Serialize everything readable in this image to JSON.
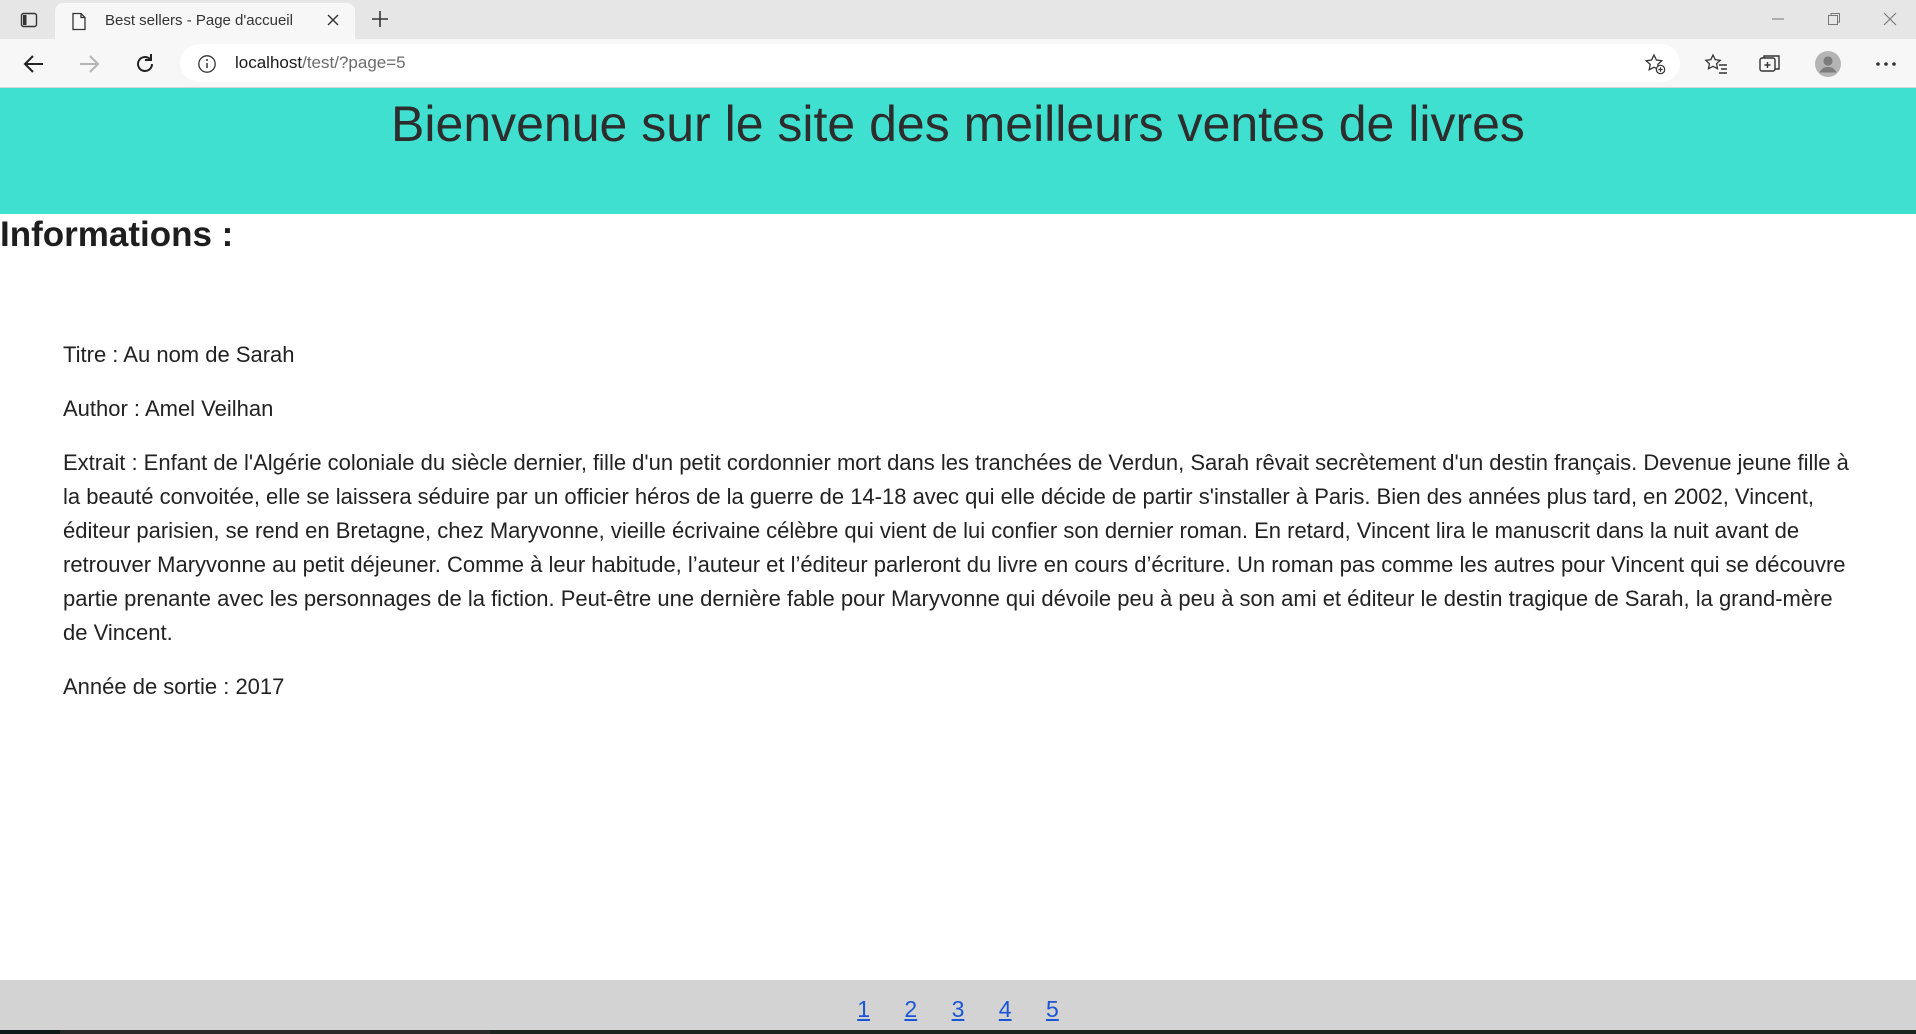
{
  "browser": {
    "tab_title": "Best sellers - Page d'accueil",
    "url_host": "localhost",
    "url_path": "/test/?page=5"
  },
  "page": {
    "banner_title": "Bienvenue sur le site des meilleurs ventes de livres",
    "section_title": "Informations :",
    "book": {
      "title_line": "Titre : Au nom de Sarah",
      "author_line": "Author : Amel Veilhan",
      "extrait_line": "Extrait : Enfant de l'Algérie coloniale du siècle dernier, fille d'un petit cordonnier mort dans les tranchées de Verdun, Sarah rêvait secrètement d'un destin français. Devenue jeune fille à la beauté convoitée, elle se laissera séduire par un officier héros de la guerre de 14-18 avec qui elle décide de partir s'installer à Paris. Bien des années plus tard, en 2002, Vincent, éditeur parisien, se rend en Bretagne, chez Maryvonne, vieille écrivaine célèbre qui vient de lui confier son dernier roman. En retard, Vincent lira le manuscrit dans la nuit avant de retrouver Maryvonne au petit déjeuner. Comme à leur habitude, l’auteur et l’éditeur parleront du livre en cours d’écriture. Un roman pas comme les autres pour Vincent qui se découvre partie prenante avec les personnages de la fiction. Peut-être une dernière fable pour Maryvonne qui dévoile peu à peu à son ami et éditeur le destin tragique de Sarah, la grand-mère de Vincent.",
      "year_line": "Année de sortie : 2017"
    },
    "pagination": [
      "1",
      "2",
      "3",
      "4",
      "5"
    ]
  },
  "colors": {
    "banner": "#40e0d0",
    "footer": "#d3d3d3",
    "link": "#1a55d6"
  },
  "icons": [
    "tab-actions-icon",
    "page-icon",
    "close-icon",
    "plus-icon",
    "minimize-icon",
    "restore-icon",
    "close-window-icon",
    "back-arrow-icon",
    "forward-arrow-icon",
    "refresh-icon",
    "info-icon",
    "add-favorite-icon",
    "favorites-icon",
    "collections-icon",
    "profile-icon",
    "more-icon"
  ]
}
